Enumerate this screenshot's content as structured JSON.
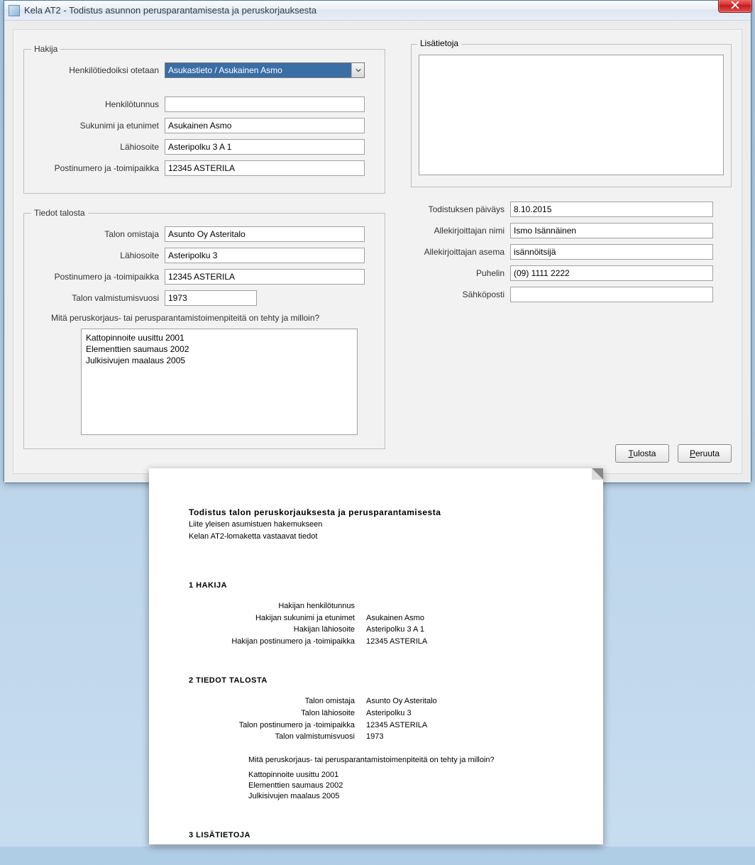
{
  "window": {
    "title": "Kela AT2 - Todistus asunnon perusparantamisesta ja peruskorjauksesta"
  },
  "hakija": {
    "legend": "Hakija",
    "henkilotiedoiksi_label": "Henkilötiedoiksi otetaan",
    "henkilotiedoiksi_value": "Asukastieto / Asukainen Asmo",
    "henkilotunnus_label": "Henkilötunnus",
    "henkilotunnus_value": "",
    "sukunimi_label": "Sukunimi ja etunimet",
    "sukunimi_value": "Asukainen Asmo",
    "lahiosoite_label": "Lähiosoite",
    "lahiosoite_value": "Asteripolku 3 A 1",
    "postinumero_label": "Postinumero ja -toimipaikka",
    "postinumero_value": "12345 ASTERILA"
  },
  "talosta": {
    "legend": "Tiedot talosta",
    "omistaja_label": "Talon omistaja",
    "omistaja_value": "Asunto Oy Asteritalo",
    "lahiosoite_label": "Lähiosoite",
    "lahiosoite_value": "Asteripolku 3",
    "postinumero_label": "Postinumero ja -toimipaikka",
    "postinumero_value": "12345 ASTERILA",
    "valmistumisvuosi_label": "Talon valmistumisvuosi",
    "valmistumisvuosi_value": "1973",
    "toimenpiteet_q": "Mitä peruskorjaus- tai perusparantamistoimenpiteitä on tehty ja milloin?",
    "toimenpiteet_value": "Kattopinnoite uusittu 2001\nElementtien saumaus 2002\nJulkisivujen maalaus 2005"
  },
  "lisatietoja": {
    "title": "Lisätietoja",
    "value": ""
  },
  "todistus": {
    "paivays_label": "Todistuksen päiväys",
    "paivays_value": "8.10.2015",
    "nimi_label": "Allekirjoittajan nimi",
    "nimi_value": "Ismo Isännäinen",
    "asema_label": "Allekirjoittajan asema",
    "asema_value": "isännöitsijä",
    "puhelin_label": "Puhelin",
    "puhelin_value": "(09) 1111 2222",
    "sahkoposti_label": "Sähköposti",
    "sahkoposti_value": ""
  },
  "buttons": {
    "tulosta_prefix": "T",
    "tulosta_rest": "ulosta",
    "peruuta_prefix": "P",
    "peruuta_rest": "eruuta"
  },
  "doc": {
    "title": "Todistus talon peruskorjauksesta ja perusparantamisesta",
    "sub1": "Liite yleisen asumistuen hakemukseen",
    "sub2": "Kelan AT2-lomaketta vastaavat tiedot",
    "sec1": "1  HAKIJA",
    "s1_k1": "Hakijan henkilötunnus",
    "s1_v1": "",
    "s1_k2": "Hakijan sukunimi ja etunimet",
    "s1_v2": "Asukainen Asmo",
    "s1_k3": "Hakijan lähiosoite",
    "s1_v3": "Asteripolku 3 A 1",
    "s1_k4": "Hakijan postinumero ja -toimipaikka",
    "s1_v4": "12345 ASTERILA",
    "sec2": "2  TIEDOT TALOSTA",
    "s2_k1": "Talon omistaja",
    "s2_v1": "Asunto Oy Asteritalo",
    "s2_k2": "Talon lähiosoite",
    "s2_v2": "Asteripolku 3",
    "s2_k3": "Talon postinumero ja -toimipaikka",
    "s2_v3": "12345 ASTERILA",
    "s2_k4": "Talon valmistumisvuosi",
    "s2_v4": "1973",
    "s2_q": "Mitä peruskorjaus- tai perusparantamistoimenpiteitä on tehty ja milloin?",
    "s2_l1": "Kattopinnoite uusittu 2001",
    "s2_l2": "Elementtien saumaus 2002",
    "s2_l3": "Julkisivujen maalaus 2005",
    "sec3": "3  LISÄTIETOJA"
  }
}
